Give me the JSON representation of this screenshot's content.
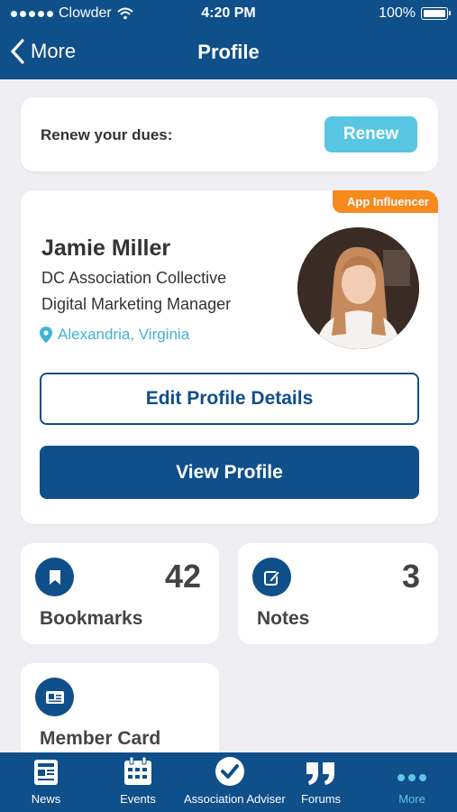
{
  "status_bar": {
    "carrier": "Clowder",
    "time": "4:20 PM",
    "battery": "100%"
  },
  "nav": {
    "back_label": "More",
    "title": "Profile"
  },
  "renew": {
    "text": "Renew your dues:",
    "button_label": "Renew"
  },
  "profile": {
    "badge": "App Influencer",
    "name": "Jamie Miller",
    "organization": "DC Association Collective",
    "role": "Digital Marketing Manager",
    "location": "Alexandria, Virginia",
    "edit_button": "Edit Profile Details",
    "view_button": "View Profile"
  },
  "tiles": {
    "bookmarks": {
      "label": "Bookmarks",
      "count": "42",
      "icon": "bookmark-icon"
    },
    "notes": {
      "label": "Notes",
      "count": "3",
      "icon": "edit-note-icon"
    },
    "member_card": {
      "label": "Member Card",
      "icon": "id-card-icon"
    }
  },
  "tab_bar": {
    "items": [
      {
        "label": "News",
        "icon": "newspaper-icon"
      },
      {
        "label": "Events",
        "icon": "calendar-icon"
      },
      {
        "label": "Association Adviser",
        "icon": "check-circle-icon"
      },
      {
        "label": "Forums",
        "icon": "quote-icon"
      },
      {
        "label": "More",
        "icon": "more-dots-icon"
      }
    ],
    "active": "More"
  },
  "colors": {
    "primary": "#0f4f8a",
    "accent": "#58c6e3",
    "badge": "#f78a1d",
    "location": "#3fb4d3",
    "background": "#eeeef3"
  }
}
